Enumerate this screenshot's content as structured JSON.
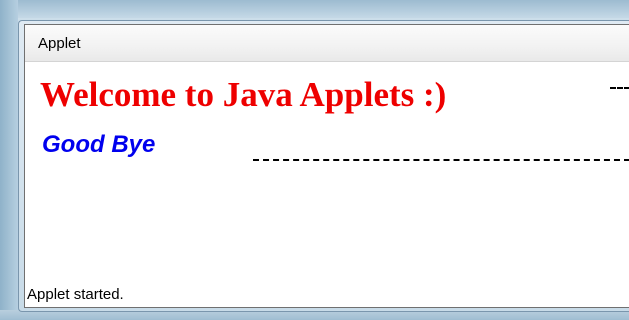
{
  "window": {
    "menu_label": "Applet"
  },
  "canvas": {
    "welcome_text": "Welcome to Java Applets :)",
    "goodbye_text": "Good Bye"
  },
  "status": {
    "text": "Applet started."
  },
  "colors": {
    "welcome": "#ee0000",
    "goodbye": "#0000ee",
    "dashes": "#000000"
  }
}
